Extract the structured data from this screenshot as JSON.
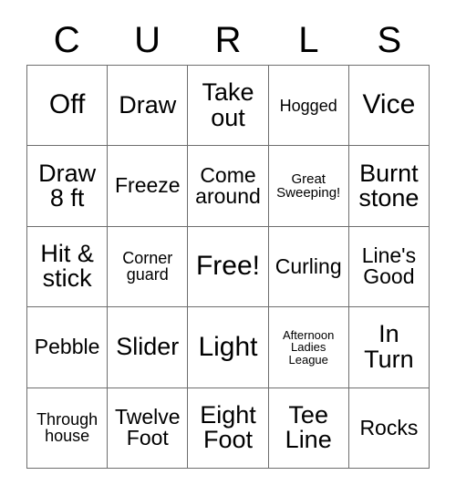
{
  "card": {
    "headers": [
      "C",
      "U",
      "R",
      "L",
      "S"
    ],
    "rows": [
      [
        {
          "text": "Off",
          "size": "xl"
        },
        {
          "text": "Draw",
          "size": "lg"
        },
        {
          "text": "Take out",
          "size": "lg"
        },
        {
          "text": "Hogged",
          "size": "sm"
        },
        {
          "text": "Vice",
          "size": "xl"
        }
      ],
      [
        {
          "text": "Draw 8 ft",
          "size": "lg"
        },
        {
          "text": "Freeze",
          "size": "md"
        },
        {
          "text": "Come around",
          "size": "md"
        },
        {
          "text": "Great Sweeping!",
          "size": "xs"
        },
        {
          "text": "Burnt stone",
          "size": "lg"
        }
      ],
      [
        {
          "text": "Hit & stick",
          "size": "lg"
        },
        {
          "text": "Corner guard",
          "size": "sm"
        },
        {
          "text": "Free!",
          "size": "xl"
        },
        {
          "text": "Curling",
          "size": "md"
        },
        {
          "text": "Line's Good",
          "size": "md"
        }
      ],
      [
        {
          "text": "Pebble",
          "size": "md"
        },
        {
          "text": "Slider",
          "size": "lg"
        },
        {
          "text": "Light",
          "size": "xl"
        },
        {
          "text": "Afternoon Ladies League",
          "size": "xxs"
        },
        {
          "text": "In Turn",
          "size": "lg"
        }
      ],
      [
        {
          "text": "Through house",
          "size": "sm"
        },
        {
          "text": "Twelve Foot",
          "size": "md"
        },
        {
          "text": "Eight Foot",
          "size": "lg"
        },
        {
          "text": "Tee Line",
          "size": "lg"
        },
        {
          "text": "Rocks",
          "size": "md"
        }
      ]
    ],
    "colors": {
      "background": "#ffffff",
      "text": "#000000",
      "grid_line": "#6e6e6e"
    }
  }
}
